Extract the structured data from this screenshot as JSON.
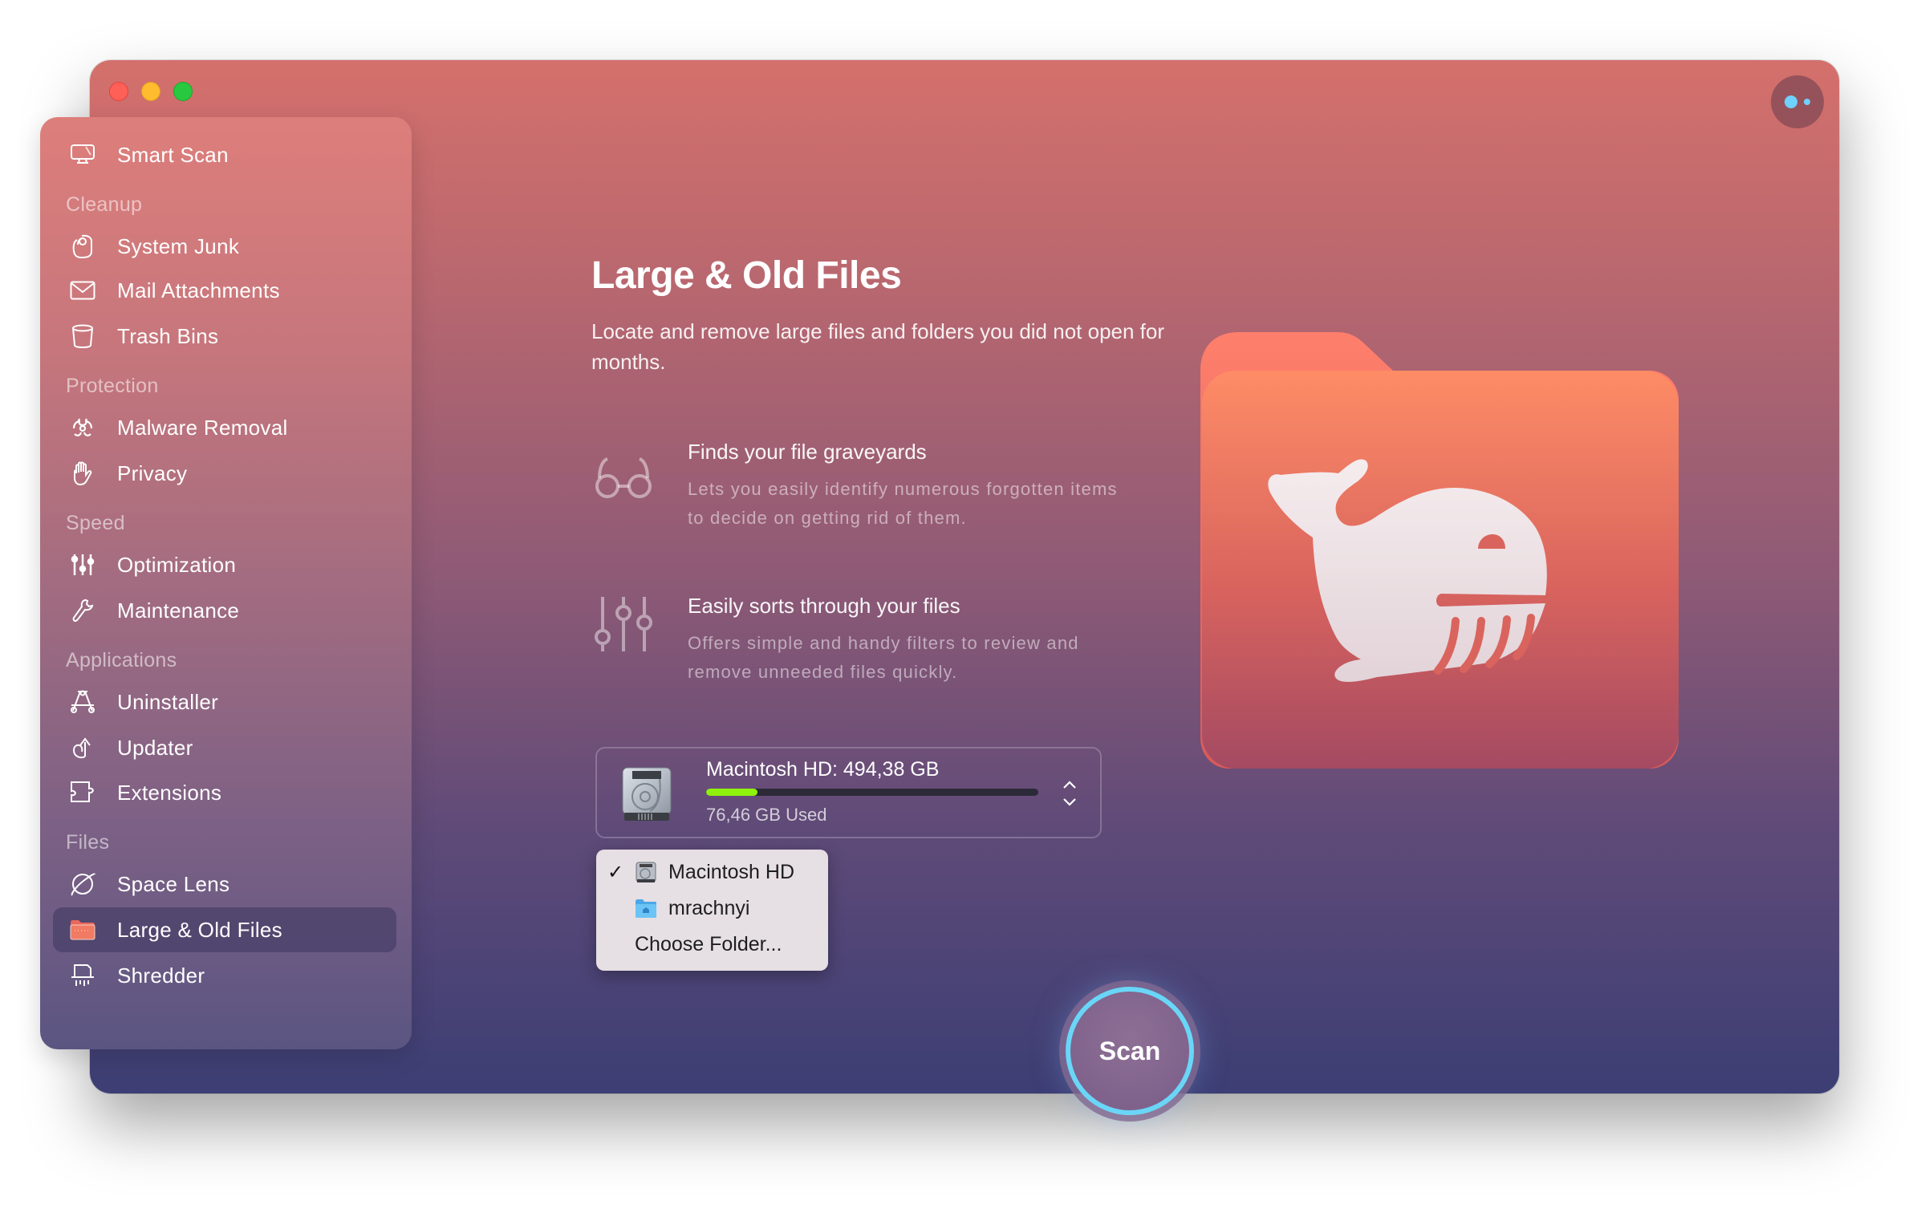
{
  "window": {
    "controls": [
      "close",
      "minimize",
      "zoom"
    ],
    "assistant_button_icon": "assistant-dots-icon"
  },
  "sidebar": {
    "top_item": {
      "label": "Smart Scan",
      "icon": "smart-scan-monitor-icon"
    },
    "sections": [
      {
        "title": "Cleanup",
        "items": [
          {
            "label": "System Junk",
            "icon": "system-junk-icon"
          },
          {
            "label": "Mail Attachments",
            "icon": "mail-envelope-icon"
          },
          {
            "label": "Trash Bins",
            "icon": "trash-bin-icon"
          }
        ]
      },
      {
        "title": "Protection",
        "items": [
          {
            "label": "Malware Removal",
            "icon": "biohazard-icon"
          },
          {
            "label": "Privacy",
            "icon": "hand-icon"
          }
        ]
      },
      {
        "title": "Speed",
        "items": [
          {
            "label": "Optimization",
            "icon": "sliders-icon"
          },
          {
            "label": "Maintenance",
            "icon": "wrench-icon"
          }
        ]
      },
      {
        "title": "Applications",
        "items": [
          {
            "label": "Uninstaller",
            "icon": "app-store-icon"
          },
          {
            "label": "Updater",
            "icon": "update-arrow-icon"
          },
          {
            "label": "Extensions",
            "icon": "puzzle-icon"
          }
        ]
      },
      {
        "title": "Files",
        "items": [
          {
            "label": "Space Lens",
            "icon": "planet-icon"
          },
          {
            "label": "Large & Old Files",
            "icon": "folder-icon",
            "selected": true
          },
          {
            "label": "Shredder",
            "icon": "shredder-icon"
          }
        ]
      }
    ]
  },
  "main": {
    "title": "Large & Old Files",
    "description": "Locate and remove large files and folders you did not open for months.",
    "features": [
      {
        "icon": "glasses-icon",
        "title": "Finds your file graveyards",
        "text": "Lets you easily identify numerous forgotten items to decide on getting rid of them."
      },
      {
        "icon": "filter-sliders-icon",
        "title": "Easily sorts through your files",
        "text": "Offers simple and handy filters to review and remove unneeded files quickly."
      }
    ],
    "disk": {
      "name": "Macintosh HD: 494,38 GB",
      "used_label": "76,46 GB Used",
      "used_fraction": 0.155,
      "bar_color": "#8ef20c"
    },
    "dropdown": {
      "items": [
        {
          "label": "Macintosh HD",
          "icon": "hard-drive-icon",
          "checked": true
        },
        {
          "label": "mrachnyi",
          "icon": "home-folder-icon",
          "checked": false
        },
        {
          "label": "Choose Folder...",
          "icon": null,
          "checked": false
        }
      ],
      "check_glyph": "✓"
    },
    "scan_button": "Scan",
    "accent_color": "#6ad6f7"
  }
}
